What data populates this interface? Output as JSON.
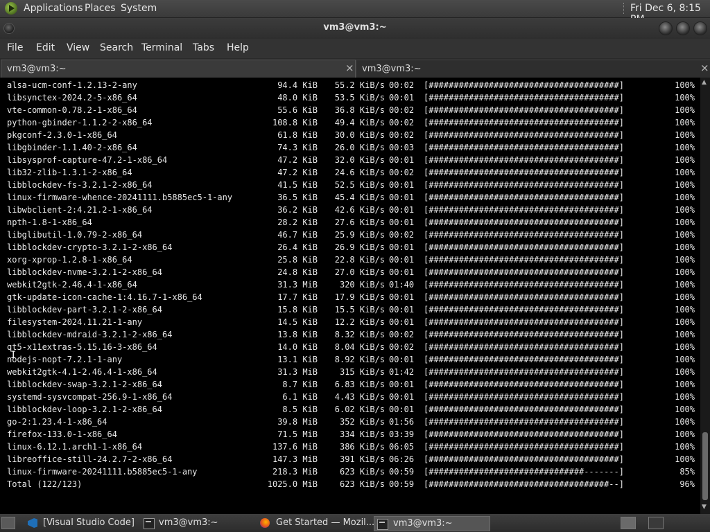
{
  "top_panel": {
    "menus": [
      "Applications",
      "Places",
      "System"
    ],
    "clock": "Fri Dec  6,  8:15 PM"
  },
  "window": {
    "title": "vm3@vm3:~"
  },
  "menubar": [
    "File",
    "Edit",
    "View",
    "Search",
    "Terminal",
    "Tabs",
    "Help"
  ],
  "tabs": [
    {
      "label": "vm3@vm3:~",
      "close": "×"
    },
    {
      "label": "vm3@vm3:~",
      "close": "×"
    }
  ],
  "terminal": {
    "rows": [
      {
        "name": "alsa-ucm-conf-1.2.13-2-any",
        "size": "94.4 KiB",
        "speed": "55.2 KiB/s",
        "eta": "00:02",
        "bar": "[######################################]",
        "pct": "100%"
      },
      {
        "name": "libsynctex-2024.2-5-x86_64",
        "size": "48.0 KiB",
        "speed": "53.5 KiB/s",
        "eta": "00:01",
        "bar": "[######################################]",
        "pct": "100%"
      },
      {
        "name": "vte-common-0.78.2-1-x86_64",
        "size": "55.6 KiB",
        "speed": "36.8 KiB/s",
        "eta": "00:02",
        "bar": "[######################################]",
        "pct": "100%"
      },
      {
        "name": "python-gbinder-1.1.2-2-x86_64",
        "size": "108.8 KiB",
        "speed": "49.4 KiB/s",
        "eta": "00:02",
        "bar": "[######################################]",
        "pct": "100%"
      },
      {
        "name": "pkgconf-2.3.0-1-x86_64",
        "size": "61.8 KiB",
        "speed": "30.0 KiB/s",
        "eta": "00:02",
        "bar": "[######################################]",
        "pct": "100%"
      },
      {
        "name": "libgbinder-1.1.40-2-x86_64",
        "size": "74.3 KiB",
        "speed": "26.0 KiB/s",
        "eta": "00:03",
        "bar": "[######################################]",
        "pct": "100%"
      },
      {
        "name": "libsysprof-capture-47.2-1-x86_64",
        "size": "47.2 KiB",
        "speed": "32.0 KiB/s",
        "eta": "00:01",
        "bar": "[######################################]",
        "pct": "100%"
      },
      {
        "name": "lib32-zlib-1.3.1-2-x86_64",
        "size": "47.2 KiB",
        "speed": "24.6 KiB/s",
        "eta": "00:02",
        "bar": "[######################################]",
        "pct": "100%"
      },
      {
        "name": "libblockdev-fs-3.2.1-2-x86_64",
        "size": "41.5 KiB",
        "speed": "52.5 KiB/s",
        "eta": "00:01",
        "bar": "[######################################]",
        "pct": "100%"
      },
      {
        "name": "linux-firmware-whence-20241111.b5885ec5-1-any",
        "size": "36.5 KiB",
        "speed": "45.4 KiB/s",
        "eta": "00:01",
        "bar": "[######################################]",
        "pct": "100%"
      },
      {
        "name": "libwbclient-2:4.21.2-1-x86_64",
        "size": "36.2 KiB",
        "speed": "42.6 KiB/s",
        "eta": "00:01",
        "bar": "[######################################]",
        "pct": "100%"
      },
      {
        "name": "npth-1.8-1-x86_64",
        "size": "28.2 KiB",
        "speed": "27.6 KiB/s",
        "eta": "00:01",
        "bar": "[######################################]",
        "pct": "100%"
      },
      {
        "name": "libglibutil-1.0.79-2-x86_64",
        "size": "46.7 KiB",
        "speed": "25.9 KiB/s",
        "eta": "00:02",
        "bar": "[######################################]",
        "pct": "100%"
      },
      {
        "name": "libblockdev-crypto-3.2.1-2-x86_64",
        "size": "26.4 KiB",
        "speed": "26.9 KiB/s",
        "eta": "00:01",
        "bar": "[######################################]",
        "pct": "100%"
      },
      {
        "name": "xorg-xprop-1.2.8-1-x86_64",
        "size": "25.8 KiB",
        "speed": "22.8 KiB/s",
        "eta": "00:01",
        "bar": "[######################################]",
        "pct": "100%"
      },
      {
        "name": "libblockdev-nvme-3.2.1-2-x86_64",
        "size": "24.8 KiB",
        "speed": "27.0 KiB/s",
        "eta": "00:01",
        "bar": "[######################################]",
        "pct": "100%"
      },
      {
        "name": "webkit2gtk-2.46.4-1-x86_64",
        "size": "31.3 MiB",
        "speed": "320 KiB/s",
        "eta": "01:40",
        "bar": "[######################################]",
        "pct": "100%"
      },
      {
        "name": "gtk-update-icon-cache-1:4.16.7-1-x86_64",
        "size": "17.7 KiB",
        "speed": "17.9 KiB/s",
        "eta": "00:01",
        "bar": "[######################################]",
        "pct": "100%"
      },
      {
        "name": "libblockdev-part-3.2.1-2-x86_64",
        "size": "15.8 KiB",
        "speed": "15.5 KiB/s",
        "eta": "00:01",
        "bar": "[######################################]",
        "pct": "100%"
      },
      {
        "name": "filesystem-2024.11.21-1-any",
        "size": "14.5 KiB",
        "speed": "12.2 KiB/s",
        "eta": "00:01",
        "bar": "[######################################]",
        "pct": "100%"
      },
      {
        "name": "libblockdev-mdraid-3.2.1-2-x86_64",
        "size": "13.8 KiB",
        "speed": "8.32 KiB/s",
        "eta": "00:02",
        "bar": "[######################################]",
        "pct": "100%"
      },
      {
        "name": "qt5-x11extras-5.15.16-3-x86_64",
        "size": "14.0 KiB",
        "speed": "8.04 KiB/s",
        "eta": "00:02",
        "bar": "[######################################]",
        "pct": "100%"
      },
      {
        "name": "nodejs-nopt-7.2.1-1-any",
        "size": "13.1 KiB",
        "speed": "8.92 KiB/s",
        "eta": "00:01",
        "bar": "[######################################]",
        "pct": "100%"
      },
      {
        "name": "webkit2gtk-4.1-2.46.4-1-x86_64",
        "size": "31.3 MiB",
        "speed": "315 KiB/s",
        "eta": "01:42",
        "bar": "[######################################]",
        "pct": "100%"
      },
      {
        "name": "libblockdev-swap-3.2.1-2-x86_64",
        "size": "8.7 KiB",
        "speed": "6.83 KiB/s",
        "eta": "00:01",
        "bar": "[######################################]",
        "pct": "100%"
      },
      {
        "name": "systemd-sysvcompat-256.9-1-x86_64",
        "size": "6.1 KiB",
        "speed": "4.43 KiB/s",
        "eta": "00:01",
        "bar": "[######################################]",
        "pct": "100%"
      },
      {
        "name": "libblockdev-loop-3.2.1-2-x86_64",
        "size": "8.5 KiB",
        "speed": "6.02 KiB/s",
        "eta": "00:01",
        "bar": "[######################################]",
        "pct": "100%"
      },
      {
        "name": "go-2:1.23.4-1-x86_64",
        "size": "39.8 MiB",
        "speed": "352 KiB/s",
        "eta": "01:56",
        "bar": "[######################################]",
        "pct": "100%"
      },
      {
        "name": "firefox-133.0-1-x86_64",
        "size": "71.5 MiB",
        "speed": "334 KiB/s",
        "eta": "03:39",
        "bar": "[######################################]",
        "pct": "100%"
      },
      {
        "name": "linux-6.12.1.arch1-1-x86_64",
        "size": "137.6 MiB",
        "speed": "386 KiB/s",
        "eta": "06:05",
        "bar": "[######################################]",
        "pct": "100%"
      },
      {
        "name": "libreoffice-still-24.2.7-2-x86_64",
        "size": "147.3 MiB",
        "speed": "391 KiB/s",
        "eta": "06:26",
        "bar": "[######################################]",
        "pct": "100%"
      },
      {
        "name": "linux-firmware-20241111.b5885ec5-1-any",
        "size": "218.3 MiB",
        "speed": "623 KiB/s",
        "eta": "00:59",
        "bar": "[###############################-------]",
        "pct": "85%"
      },
      {
        "name": "Total (122/123)",
        "size": "1025.0 MiB",
        "speed": "623 KiB/s",
        "eta": "00:59",
        "bar": "[####################################--]",
        "pct": "96%"
      }
    ]
  },
  "taskbar": {
    "tasks": [
      {
        "label": "[Visual Studio Code]",
        "icon": "vscode-icon"
      },
      {
        "label": "vm3@vm3:~",
        "icon": "terminal-icon"
      },
      {
        "label": "Get Started — Mozil...",
        "icon": "firefox-icon"
      },
      {
        "label": "vm3@vm3:~",
        "icon": "terminal-icon"
      }
    ]
  }
}
